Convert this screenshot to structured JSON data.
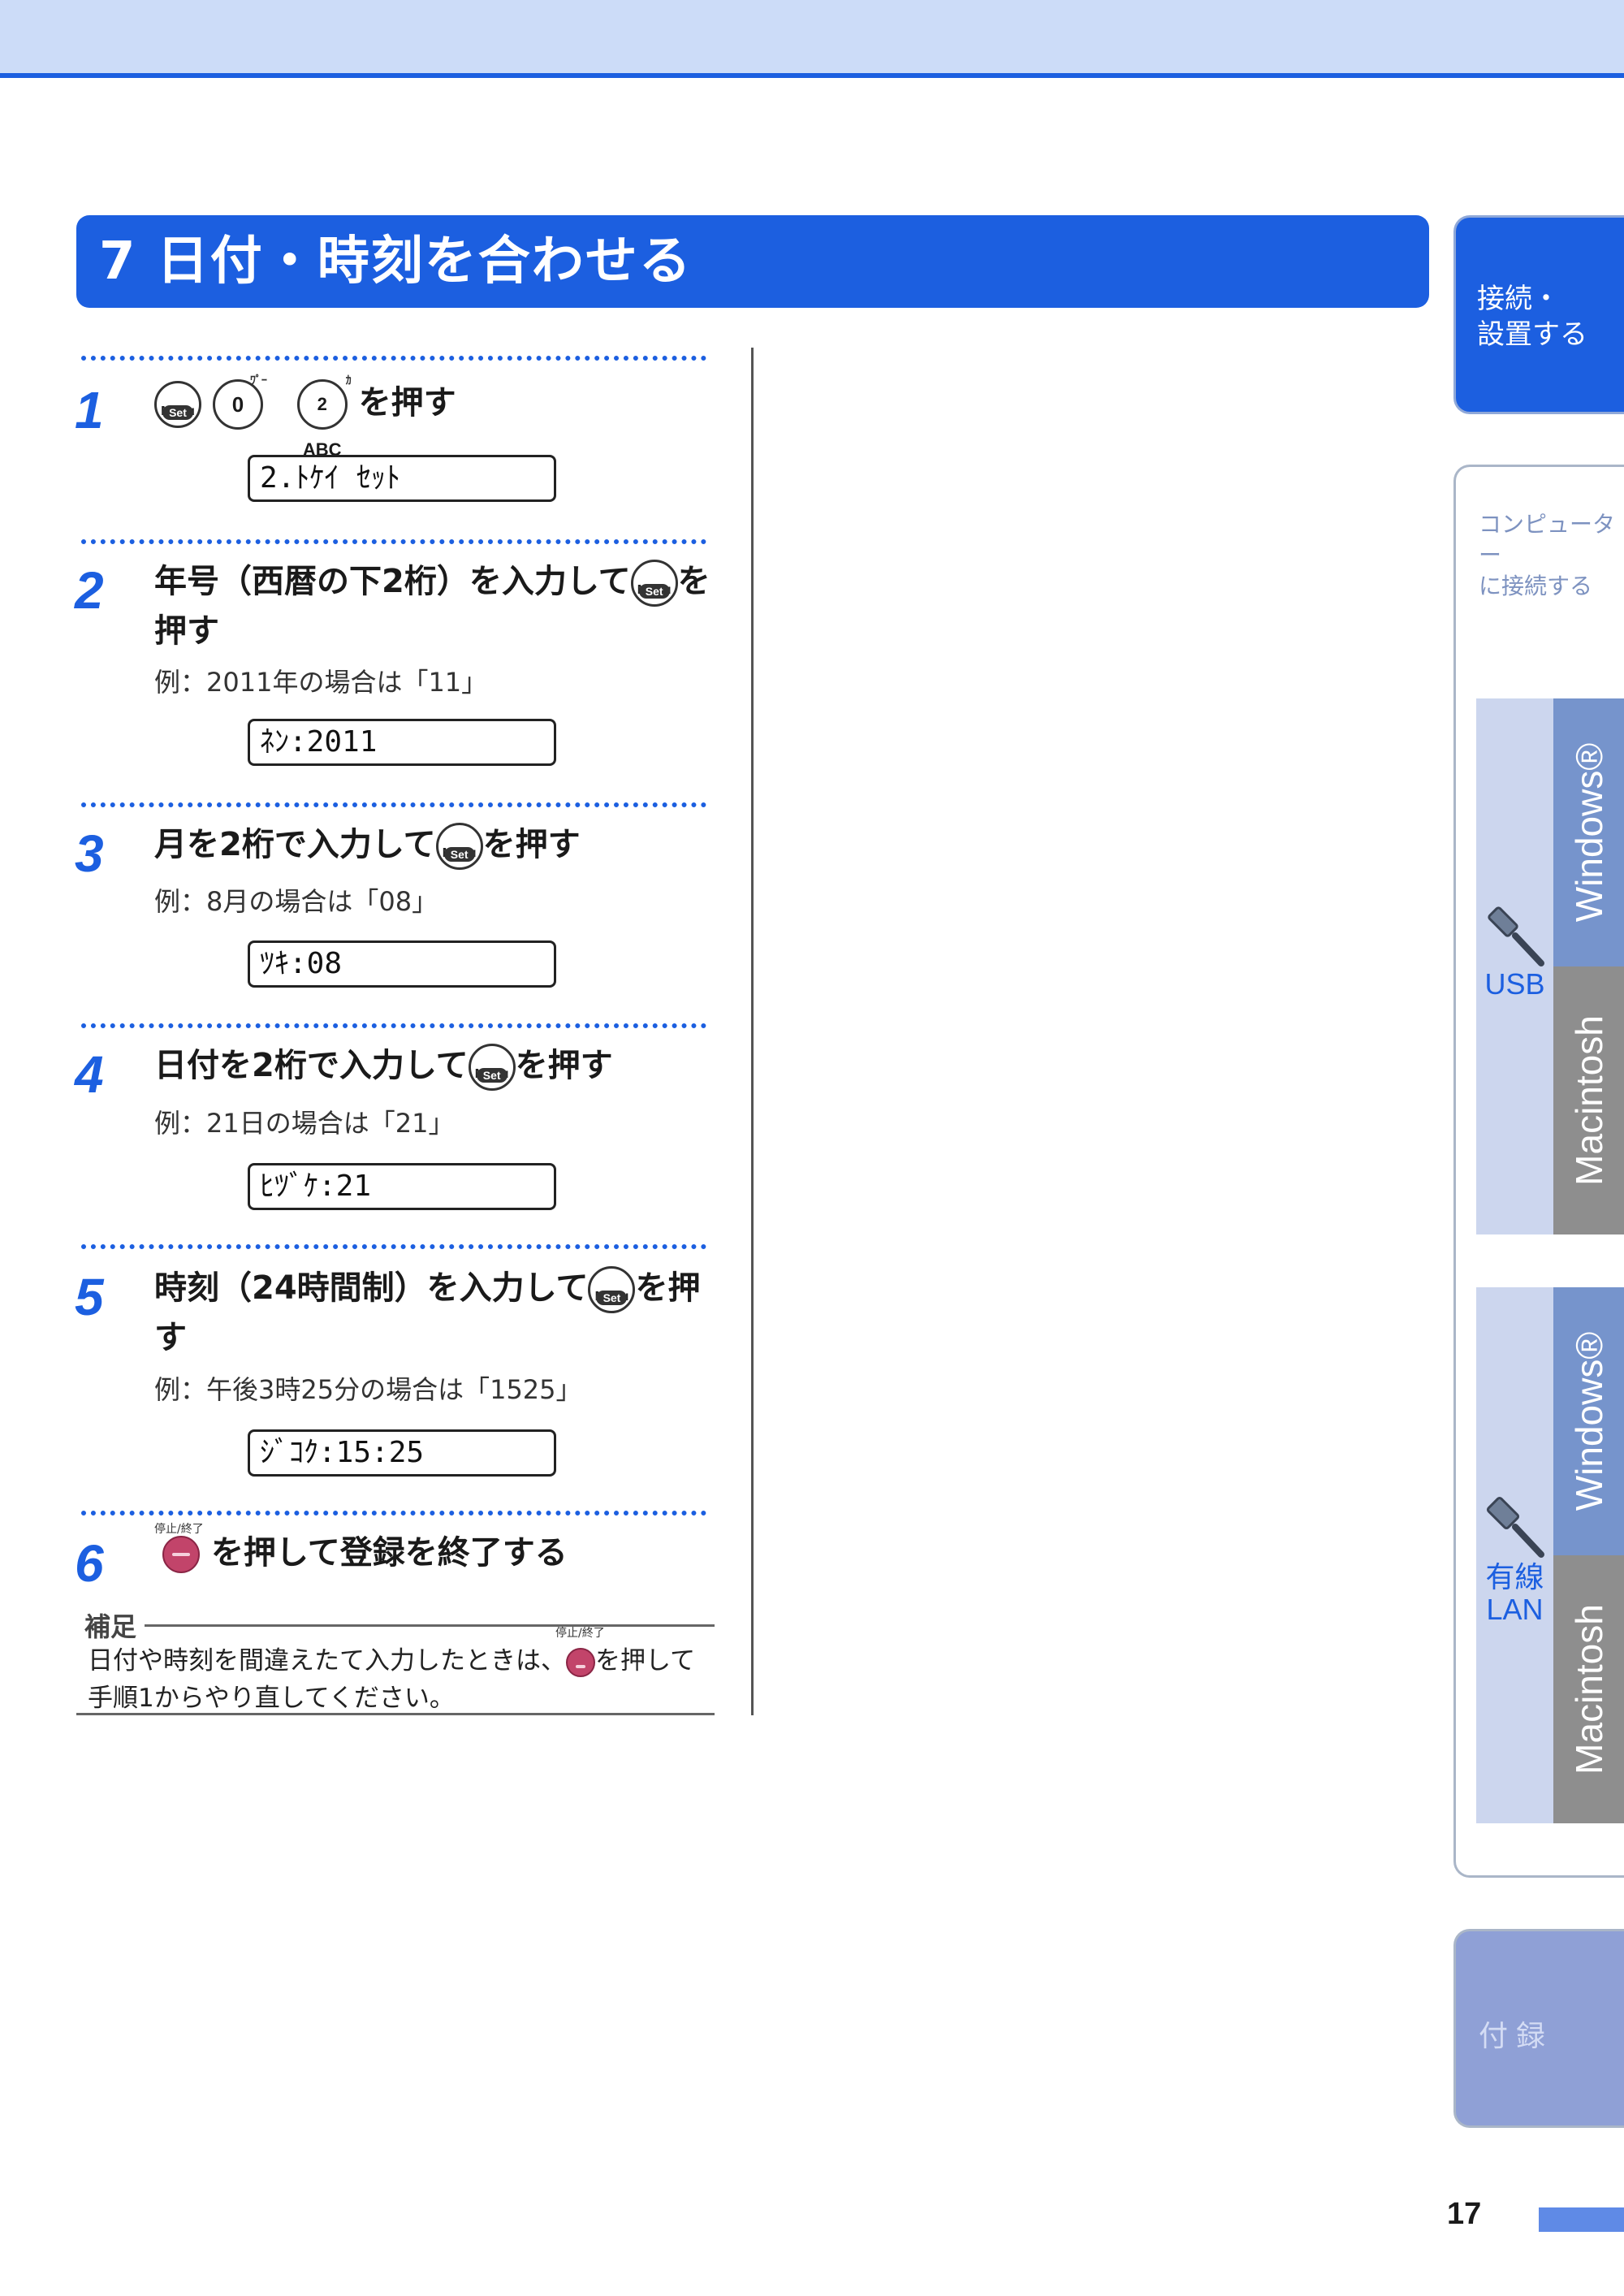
{
  "section": {
    "number": "7",
    "title": "日付・時刻を合わせる"
  },
  "steps": [
    {
      "num": "1",
      "text_after": "を押す",
      "keys": [
        "Menu Set",
        "0",
        "2 ABC"
      ],
      "key_superscripts": [
        "ﾜﾟｰ",
        "ｶ"
      ],
      "lcd": "2.ﾄｹｲ ｾｯﾄ"
    },
    {
      "num": "2",
      "text_before": "年号（西暦の下2桁）を入力して",
      "text_after": "を",
      "text_cont": "押す",
      "example": "例：2011年の場合は「11」",
      "lcd": "ﾈﾝ:2011"
    },
    {
      "num": "3",
      "text_before": "月を2桁で入力して",
      "text_after": "を押す",
      "example": "例：8月の場合は「08」",
      "lcd": "ﾂｷ:08"
    },
    {
      "num": "4",
      "text_before": "日付を2桁で入力して",
      "text_after": "を押す",
      "example": "例：21日の場合は「21」",
      "lcd": "ﾋﾂﾞｹ:21"
    },
    {
      "num": "5",
      "text_before": "時刻（24時間制）を入力して",
      "text_after": "を押",
      "text_cont": "す",
      "example": "例：午後3時25分の場合は「1525」",
      "lcd": "ｼﾞｺｸ:15:25"
    },
    {
      "num": "6",
      "stop_label": "停止/終了",
      "text_after": "を押して登録を終了する"
    }
  ],
  "menu_button": {
    "top": "Menu",
    "bottom": "Set"
  },
  "hosoku": {
    "badge": "補足",
    "line1_before": "日付や時刻を間違えたて入力したときは、",
    "line1_after": "を押して",
    "line2": "手順1からやり直してください。",
    "stop_label": "停止/終了"
  },
  "sidebar": {
    "connect_tab": {
      "line1": "接続・",
      "line2": "設置する"
    },
    "pc_tab": {
      "line1": "コンピューター",
      "line2": "に接続する"
    },
    "usb": {
      "label": "USB",
      "windows": "Windows®",
      "mac": "Macintosh"
    },
    "lan": {
      "line1": "有線",
      "line2": "LAN",
      "windows": "Windows®",
      "mac": "Macintosh"
    },
    "appendix_tab": "付録"
  },
  "page_number": "17",
  "colors": {
    "accent": "#1c5fe0",
    "windows": "#7694cc",
    "mac": "#8e8e8e",
    "light": "#ccd6ee",
    "stop": "#c2446a"
  }
}
